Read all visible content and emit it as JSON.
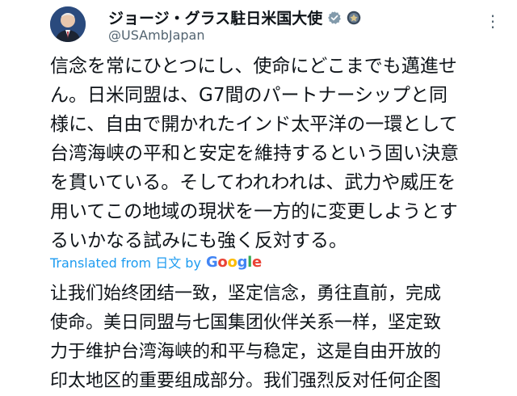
{
  "header": {
    "display_name": "ジョージ・グラス駐日米国大使",
    "handle": "@USAmbJapan",
    "more_label": "⋮"
  },
  "tweet": {
    "original_lines": [
      "信念を常にひとつにし、使命にどこまでも邁進せ",
      "ん。日米同盟は、G7間のパートナーシップと同",
      "様に、自由で開かれたインド太平洋の一環として",
      "台湾海峡の平和と安定を維持するという固い決意",
      "を貫いている。そしてわれわれは、武力や威圧を",
      "用いてこの地域の現状を一方的に変更しようとす",
      "るいかなる試みにも強く反対する。"
    ],
    "translation_label": "Translated from 日文 by",
    "translation_provider": "Google",
    "translated_lines": [
      "让我们始终团结一致，坚定信念，勇往直前，完成",
      "使命。美日同盟与七国集团伙伴关系一样，坚定致",
      "力于维护台湾海峡的和平与稳定，这是自由开放的",
      "印太地区的重要组成部分。我们强烈反对任何企图"
    ]
  },
  "colors": {
    "link": "#1d9bf0",
    "verified": "#829aab",
    "text": "#0f1419",
    "secondary": "#536471"
  },
  "icons": [
    "verified-badge-icon",
    "government-seal-icon",
    "more-icon"
  ]
}
